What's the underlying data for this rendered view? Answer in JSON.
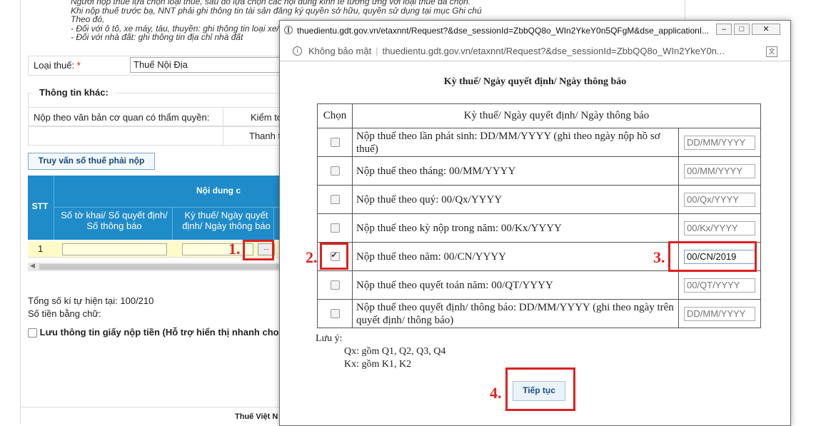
{
  "background": {
    "notes": [
      "Người nộp thuế lựa chọn loại thuế, sau đó lựa chọn các nội dung kinh tế tương ứng với loại thuế đã chọn.",
      "Khi nộp thuế trước bạ, NNT phải ghi thông tin tài sản đăng ký quyền sở hữu, quyền sử dụng tại mục Ghi chú",
      "Theo đó,",
      "- Đối với ô tô, xe máy, tàu, thuyền: ghi thông tin loại xe/",
      "- Đối với nhà đất: ghi thông tin địa chỉ nhà đất"
    ],
    "tax_type_label": "Loại thuế:",
    "tax_type_required": "*",
    "tax_type_value": "Thuế Nội Địa",
    "other_info_legend": "Thông tin khác:",
    "submit_by_doc_label": "Nộp theo văn bản cơ quan có thẩm quyền:",
    "inspect_label": "Kiểm to",
    "audit_label": "Thanh t",
    "query_button": "Truy vấn số thuế phải nộp",
    "grid": {
      "stt_header": "STT",
      "content_header": "Nội dung c",
      "col1_header_line1": "Số tờ khai/ Số quyết định/",
      "col1_header_line2": "Số thông báo",
      "col2_header_line1": "Kỳ thuế/ Ngày quyết",
      "col2_header_line2": "định/ Ngày thông báo",
      "row_stt": "1",
      "picker_button": "..."
    },
    "char_count": "Tổng số kí tự hiện tại: 100/210",
    "amount_words_label": "Số tiền bằng chữ:",
    "save_info_label": "Lưu thông tin giấy nộp tiền (Hỗ trợ hiển thị nhanh cho",
    "footer_title": "Thuế Việt N"
  },
  "popup": {
    "window_title": "thuedientu.gdt.gov.vn/etaxnnt/Request?&dse_sessionId=ZbbQQ8o_WIn2YkeY0n5QFgM&dse_applicationI...",
    "window_controls": {
      "minimize": "–",
      "maximize": "□",
      "close": "✕"
    },
    "address": {
      "security_label": "Không bảo mật",
      "separator": "|",
      "url": "thuedientu.gdt.gov.vn/etaxnnt/Request?&dse_sessionId=ZbbQQ8o_WIn2YkeY0n..."
    },
    "heading": "Kỳ thuế/ Ngày quyết định/ Ngày thông báo",
    "table": {
      "header_select": "Chọn",
      "header_desc": "Kỳ thuế/ Ngày quyết định/ Ngày thông báo",
      "rows": [
        {
          "label": "Nộp thuế theo lần phát sinh: DD/MM/YYYY (ghi theo ngày nộp hồ sơ thuế)",
          "placeholder": "DD/MM/YYYY",
          "value": "",
          "checked": false
        },
        {
          "label": "Nộp thuế theo tháng: 00/MM/YYYY",
          "placeholder": "00/MM/YYYY",
          "value": "",
          "checked": false
        },
        {
          "label": "Nộp thuế theo quý: 00/Qx/YYYY",
          "placeholder": "00/Qx/YYYY",
          "value": "",
          "checked": false
        },
        {
          "label": "Nộp thuế theo kỳ nộp trong năm: 00/Kx/YYYY",
          "placeholder": "00/Kx/YYYY",
          "value": "",
          "checked": false
        },
        {
          "label": "Nộp thuế theo năm: 00/CN/YYYY",
          "placeholder": "00/CN/YYYY",
          "value": "00/CN/2019",
          "checked": true
        },
        {
          "label": "Nộp thuế theo quyết toán năm: 00/QT/YYYY",
          "placeholder": "00/QT/YYYY",
          "value": "",
          "checked": false
        },
        {
          "label": "Nộp thuế theo quyết định/ thông báo: DD/MM/YYYY (ghi theo ngày trên quyết định/ thông báo)",
          "placeholder": "DD/MM/YYYY",
          "value": "",
          "checked": false
        }
      ]
    },
    "notes": {
      "title": "Lưu ý:",
      "qx": "Qx: gồm Q1, Q2, Q3, Q4",
      "kx": "Kx: gồm K1, K2"
    },
    "continue_button": "Tiếp tục"
  },
  "callouts": {
    "step1": "1.",
    "step2": "2.",
    "step3": "3.",
    "step4": "4."
  },
  "colors": {
    "callout": "#e02020",
    "grid_header": "#1f8bc9",
    "row_highlight": "#fffbc8"
  }
}
